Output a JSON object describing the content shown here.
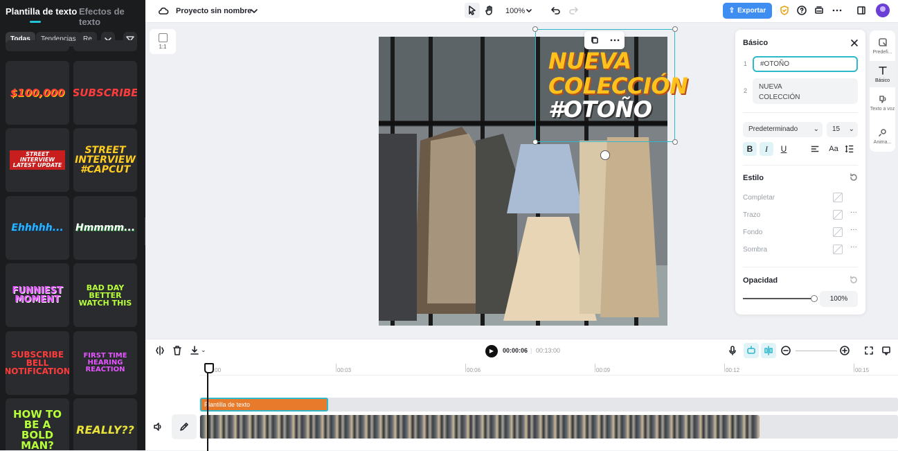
{
  "left_panel": {
    "tabs": [
      {
        "label": "Plantilla de texto"
      },
      {
        "label": "Efectos de texto"
      }
    ],
    "filters": [
      {
        "label": "Todas"
      },
      {
        "label": "Tendencias"
      },
      {
        "label": "Re"
      }
    ],
    "templates": [
      {
        "text": "$100,000",
        "color": "#ff3b3b"
      },
      {
        "text": "SUBSCRIBE",
        "color": "#ff3b3b"
      },
      {
        "text": "STREET INTERVIEW LATEST UPDATE",
        "color": "#ff3b3b"
      },
      {
        "text": "STREET INTERVIEW #CAPCUT",
        "color": "#ffcc22"
      },
      {
        "text": "Ehhhhh...",
        "color": "#2db4ff"
      },
      {
        "text": "Hmmmm...",
        "color": "#ffffff"
      },
      {
        "text": "FUNNIEST MOMENT",
        "color": "#e455ff"
      },
      {
        "text": "BAD DAY BETTER WATCH THIS",
        "color": "#b6ff3a"
      },
      {
        "text": "SUBSCRIBE BELL NOTIFICATION",
        "color": "#ff3b3b"
      },
      {
        "text": "FIRST TIME HEARING REACTION",
        "color": "#e455ff"
      },
      {
        "text": "HOW TO BE A BOLD MAN?",
        "color": "#b6ff3a"
      },
      {
        "text": "REALLY??",
        "color": "#e8e23a"
      }
    ]
  },
  "topbar": {
    "project_name": "Proyecto sin nombre",
    "zoom": "100%",
    "export_label": "Exportar"
  },
  "canvas": {
    "ratio_label": "1:1",
    "overlay_lines": [
      "NUEVA",
      "COLECCIÓN",
      "#OTOÑO"
    ]
  },
  "right_rail": [
    {
      "label": "Predefi..."
    },
    {
      "label": "Básico"
    },
    {
      "label": "Texto a voz"
    },
    {
      "label": "Anima..."
    }
  ],
  "panel": {
    "title": "Básico",
    "texts": [
      {
        "index": "1",
        "value": "#OTOÑO"
      },
      {
        "index": "2",
        "value": "NUEVA COLECCIÓN"
      }
    ],
    "font": "Predeterminado",
    "size": "15",
    "style_title": "Estilo",
    "style_rows": [
      "Completar",
      "Trazo",
      "Fondo",
      "Sombra"
    ],
    "opacity_title": "Opacidad",
    "opacity_value": "100%",
    "opacity_level": 1.0
  },
  "timeline": {
    "current_time": "00:00:06",
    "total_time": "00:13:00",
    "ticks": [
      "00:00",
      "00:03",
      "00:06",
      "00:09",
      "00:12",
      "00:15"
    ],
    "text_clip_label": "Plantilla de texto"
  },
  "colors": {
    "accent": "#2fb8cc",
    "export": "#3d8ef0",
    "text_clip": "#e77a2b"
  }
}
